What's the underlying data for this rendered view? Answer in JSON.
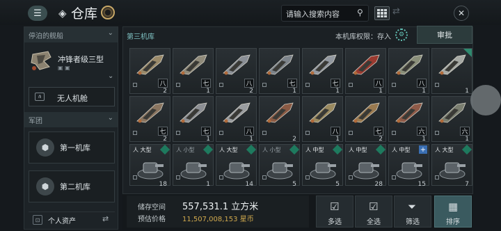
{
  "header": {
    "title": "仓库",
    "search_placeholder": "请输入搜索内容"
  },
  "sidebar": {
    "docked_section": "停泊的舰船",
    "ship_name": "冲锋者级三型",
    "drone_bay": "无人机舱",
    "legion_section": "军团",
    "hangar_1": "第一机库",
    "hangar_2": "第二机库",
    "personal_assets": "个人资产"
  },
  "main": {
    "hangar_title": "第三机库",
    "permission_label": "本机库权限：",
    "permission_value": "存入",
    "approve_label": "审批"
  },
  "items": [
    {
      "tier": "八",
      "count": "2",
      "corner": false
    },
    {
      "tier": "七",
      "count": "1",
      "corner": false
    },
    {
      "tier": "八",
      "count": "2",
      "corner": false
    },
    {
      "tier": "七",
      "count": "1",
      "corner": false
    },
    {
      "tier": "七",
      "count": "1",
      "corner": false
    },
    {
      "tier": "八",
      "count": "1",
      "corner": false
    },
    {
      "tier": "八",
      "count": "1",
      "corner": false
    },
    {
      "tier": "",
      "count": "1",
      "corner": true
    },
    {
      "tier": "七",
      "count": "2",
      "corner": false
    },
    {
      "tier": "七",
      "count": "1",
      "corner": false
    },
    {
      "tier": "八",
      "count": "1",
      "corner": false
    },
    {
      "tier": "",
      "count": "2",
      "corner": false
    },
    {
      "tier": "八",
      "count": "1",
      "corner": false
    },
    {
      "tier": "七",
      "count": "2",
      "corner": false
    },
    {
      "tier": "六",
      "count": "1",
      "corner": false
    },
    {
      "tier": "六",
      "count": "1",
      "corner": false
    }
  ],
  "modules": [
    {
      "size": "大型",
      "badge": "dot",
      "count": "18"
    },
    {
      "size": "小型",
      "badge": "dot",
      "count": "1"
    },
    {
      "size": "大型",
      "badge": "dot",
      "count": "14"
    },
    {
      "size": "小型",
      "badge": "dot",
      "count": "5"
    },
    {
      "size": "中型",
      "badge": "dot",
      "count": "5"
    },
    {
      "size": "中型",
      "badge": "dot",
      "count": "28"
    },
    {
      "size": "中型",
      "badge": "plus",
      "count": "15"
    },
    {
      "size": "大型",
      "badge": "dot",
      "count": "7"
    }
  ],
  "footer": {
    "space_label": "储存空间",
    "space_value": "557,531.1 立方米",
    "price_label": "预估价格",
    "price_value": "11,507,008,153 星币",
    "multi_select": "多选",
    "select_all": "全选",
    "filter": "筛选",
    "sort": "排序"
  }
}
